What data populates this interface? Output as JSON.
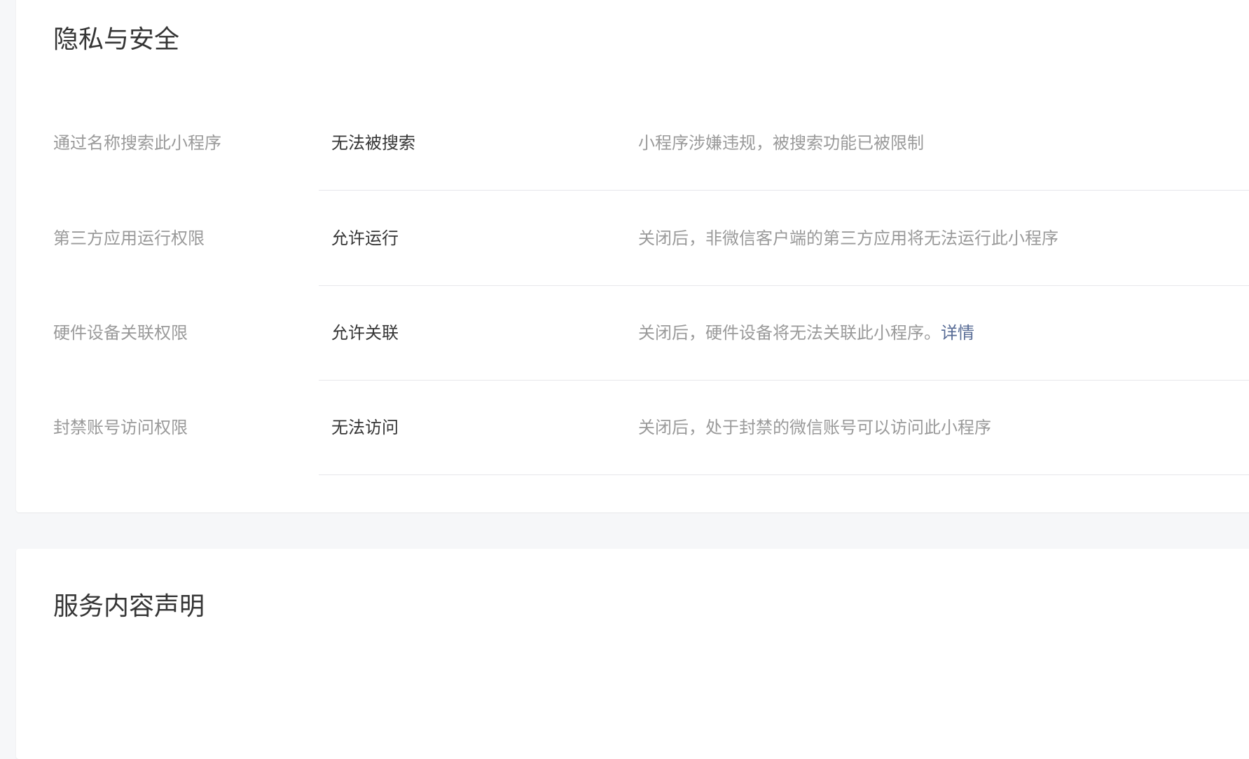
{
  "privacy": {
    "title": "隐私与安全",
    "rows": [
      {
        "label": "通过名称搜索此小程序",
        "value": "无法被搜索",
        "desc": "小程序涉嫌违规，被搜索功能已被限制"
      },
      {
        "label": "第三方应用运行权限",
        "value": "允许运行",
        "desc": "关闭后，非微信客户端的第三方应用将无法运行此小程序"
      },
      {
        "label": "硬件设备关联权限",
        "value": "允许关联",
        "desc": "关闭后，硬件设备将无法关联此小程序。",
        "link": "详情"
      },
      {
        "label": "封禁账号访问权限",
        "value": "无法访问",
        "desc": "关闭后，处于封禁的微信账号可以访问此小程序"
      }
    ]
  },
  "service": {
    "title": "服务内容声明"
  }
}
